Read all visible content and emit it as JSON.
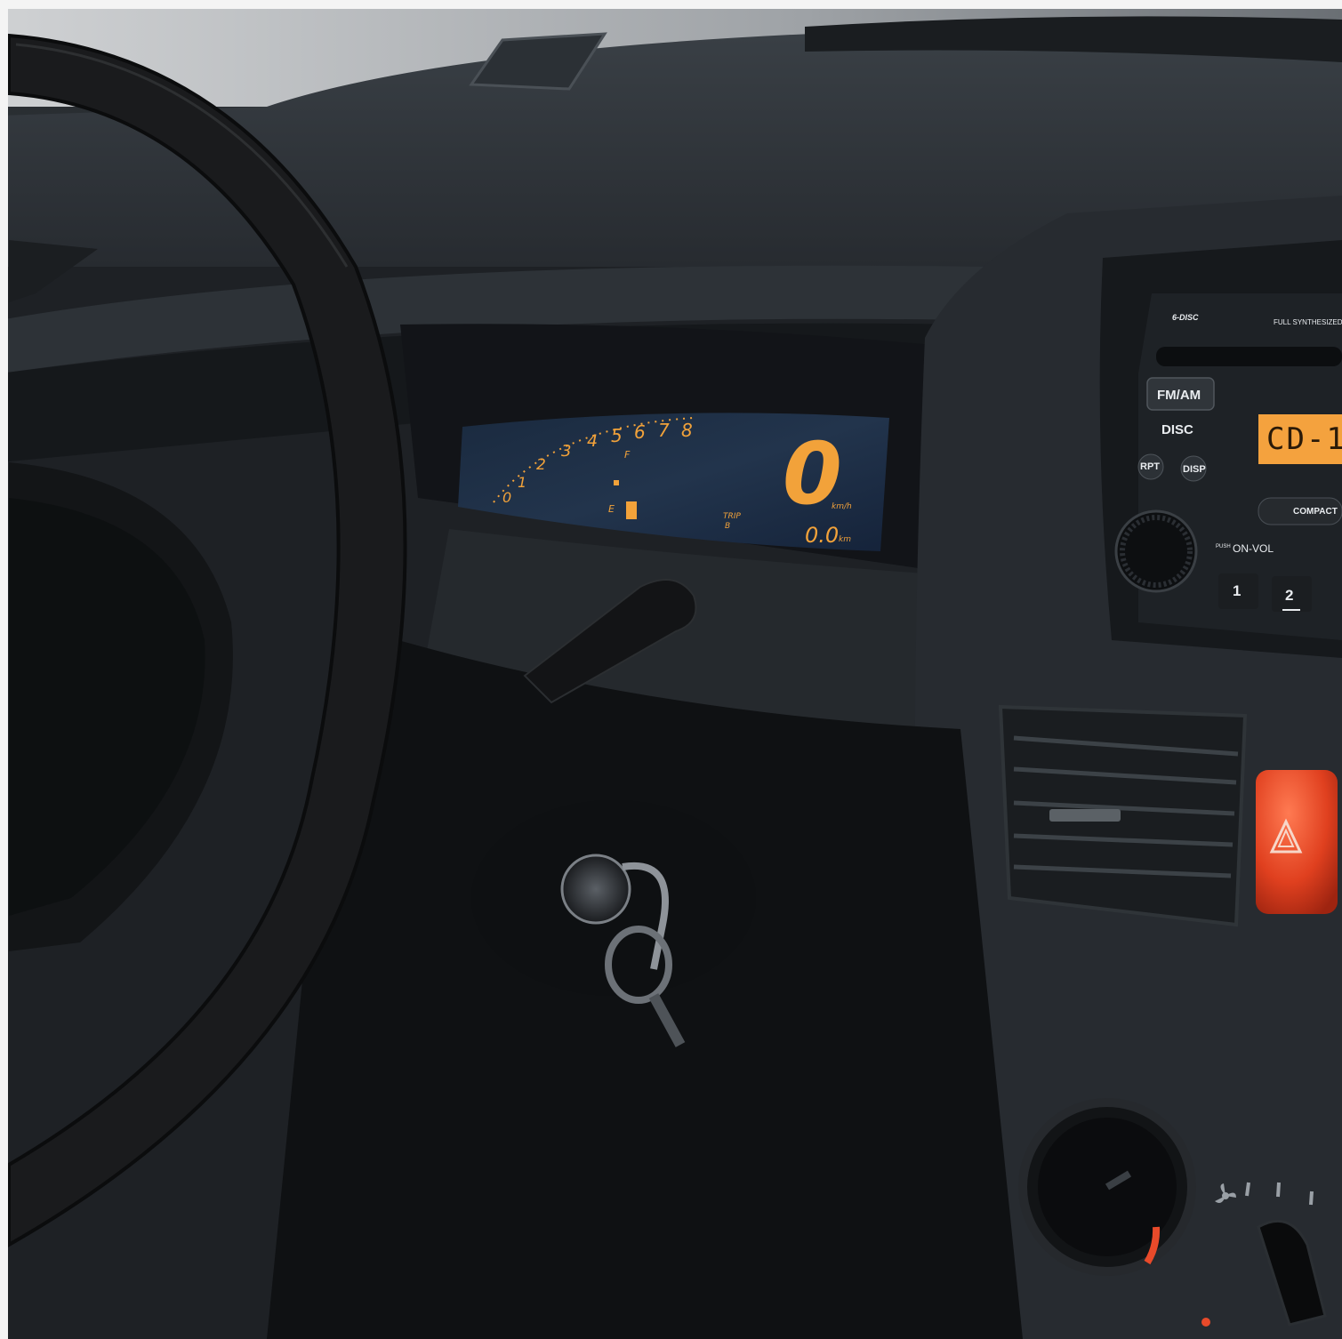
{
  "colors": {
    "dashboard": "#23272b",
    "lcd_amber": "#f2a23a",
    "lcd_bg": "#1c2d44",
    "hazard_red": "#e84a2a"
  },
  "cluster": {
    "tach_ticks": [
      "0",
      "1",
      "2",
      "3",
      "4",
      "5",
      "6",
      "7",
      "8"
    ],
    "fuel_full": "F",
    "fuel_empty": "E",
    "speed": "0",
    "speed_unit": "km/h",
    "trip_label": "TRIP",
    "trip_sub": "B",
    "odometer": "0.0",
    "odometer_unit": "km"
  },
  "radio": {
    "brand_badge": "6-DISC",
    "header_text": "FULL SYNTHESIZED",
    "fm_am": "FM/AM",
    "disc": "DISC",
    "rpt": "RPT",
    "disp": "DISP",
    "display_text": "CD-1",
    "compact": "COMPACT",
    "push_label": "PUSH",
    "on_vol": "ON-VOL",
    "preset_1": "1",
    "preset_2": "2"
  },
  "icons": {
    "hazard": "hazard-triangle-icon",
    "fan": "fan-icon",
    "key": "ignition-key-icon"
  }
}
